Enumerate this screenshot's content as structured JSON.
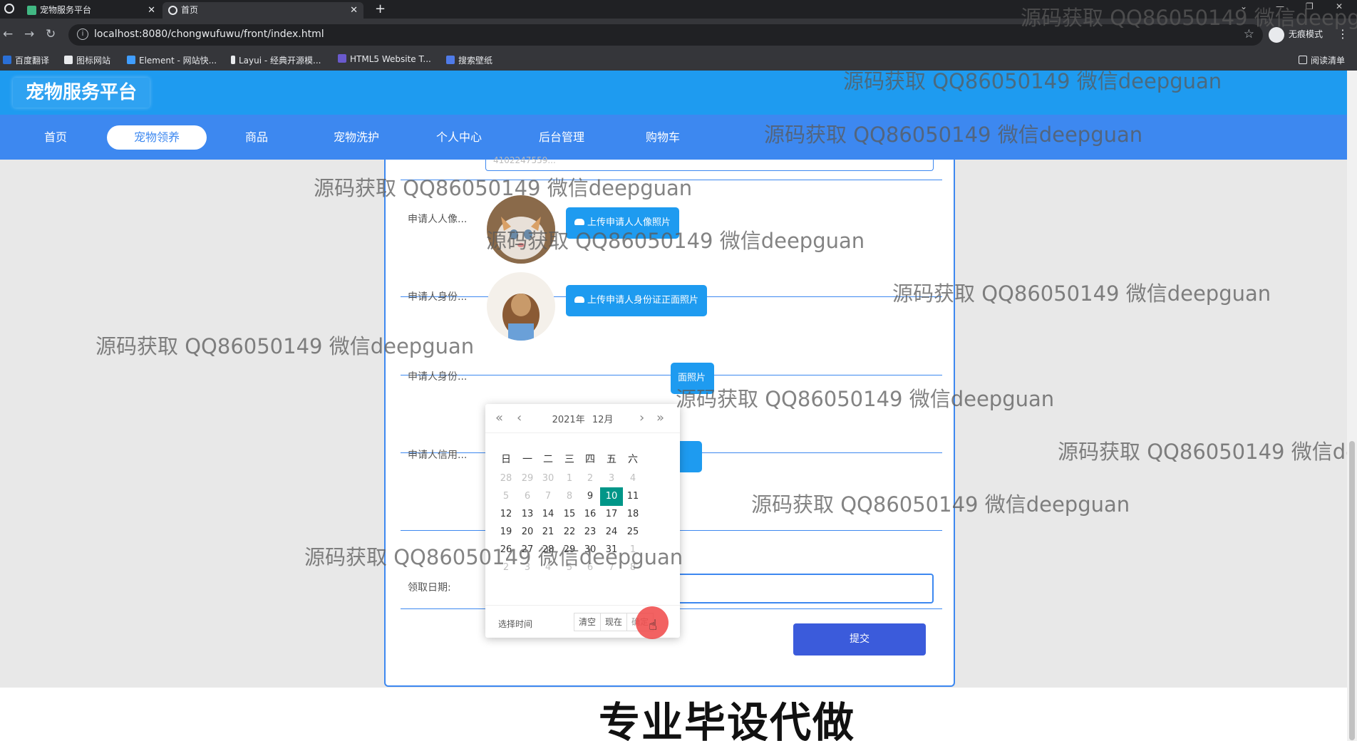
{
  "browser": {
    "tabs": [
      {
        "title": "宠物服务平台",
        "active": false
      },
      {
        "title": "首页",
        "active": true
      }
    ],
    "url": "localhost:8080/chongwufuwu/front/index.html",
    "incognito_label": "无痕模式",
    "bookmarks": [
      "百度翻译",
      "图标网站",
      "Element - 网站快...",
      "Layui - 经典开源模...",
      "HTML5 Website T...",
      "搜索壁纸"
    ],
    "reading_list": "阅读清单"
  },
  "site": {
    "logo": "宠物服务平台",
    "nav": [
      "首页",
      "宠物领养",
      "商品",
      "宠物洗护",
      "个人中心",
      "后台管理",
      "购物车"
    ],
    "active_nav": "宠物领养"
  },
  "form": {
    "top_input_value": "4102247559... ",
    "fields": [
      {
        "label": "申请人人像...",
        "button": "上传申请人人像照片"
      },
      {
        "label": "申请人身份...",
        "button": "上传申请人身份证正面照片"
      },
      {
        "label": "申请人身份...",
        "button": "面照片"
      },
      {
        "label": "申请人信用..."
      }
    ],
    "date_label": "领取日期:",
    "date_value": "",
    "submit": "提交"
  },
  "datepicker": {
    "year": "2021年",
    "month": "12月",
    "weekdays": [
      "日",
      "一",
      "二",
      "三",
      "四",
      "五",
      "六"
    ],
    "weeks": [
      [
        "28",
        "29",
        "30",
        "1",
        "2",
        "3",
        "4"
      ],
      [
        "5",
        "6",
        "7",
        "8",
        "9",
        "10",
        "11"
      ],
      [
        "12",
        "13",
        "14",
        "15",
        "16",
        "17",
        "18"
      ],
      [
        "19",
        "20",
        "21",
        "22",
        "23",
        "24",
        "25"
      ],
      [
        "26",
        "27",
        "28",
        "29",
        "30",
        "31",
        "1"
      ],
      [
        "2",
        "3",
        "4",
        "5",
        "6",
        "7",
        "8"
      ]
    ],
    "disabled_first_week": true,
    "selected": "10",
    "select_time": "选择时间",
    "clear": "清空",
    "now": "现在",
    "confirm": "确定"
  },
  "watermark": "源码获取 QQ86050149 微信deepguan",
  "caption": "专业毕设代做",
  "colors": {
    "header": "#1e9bf0",
    "navbar": "#3d88f0",
    "selected_day": "#009688",
    "submit": "#3b5bdb"
  }
}
